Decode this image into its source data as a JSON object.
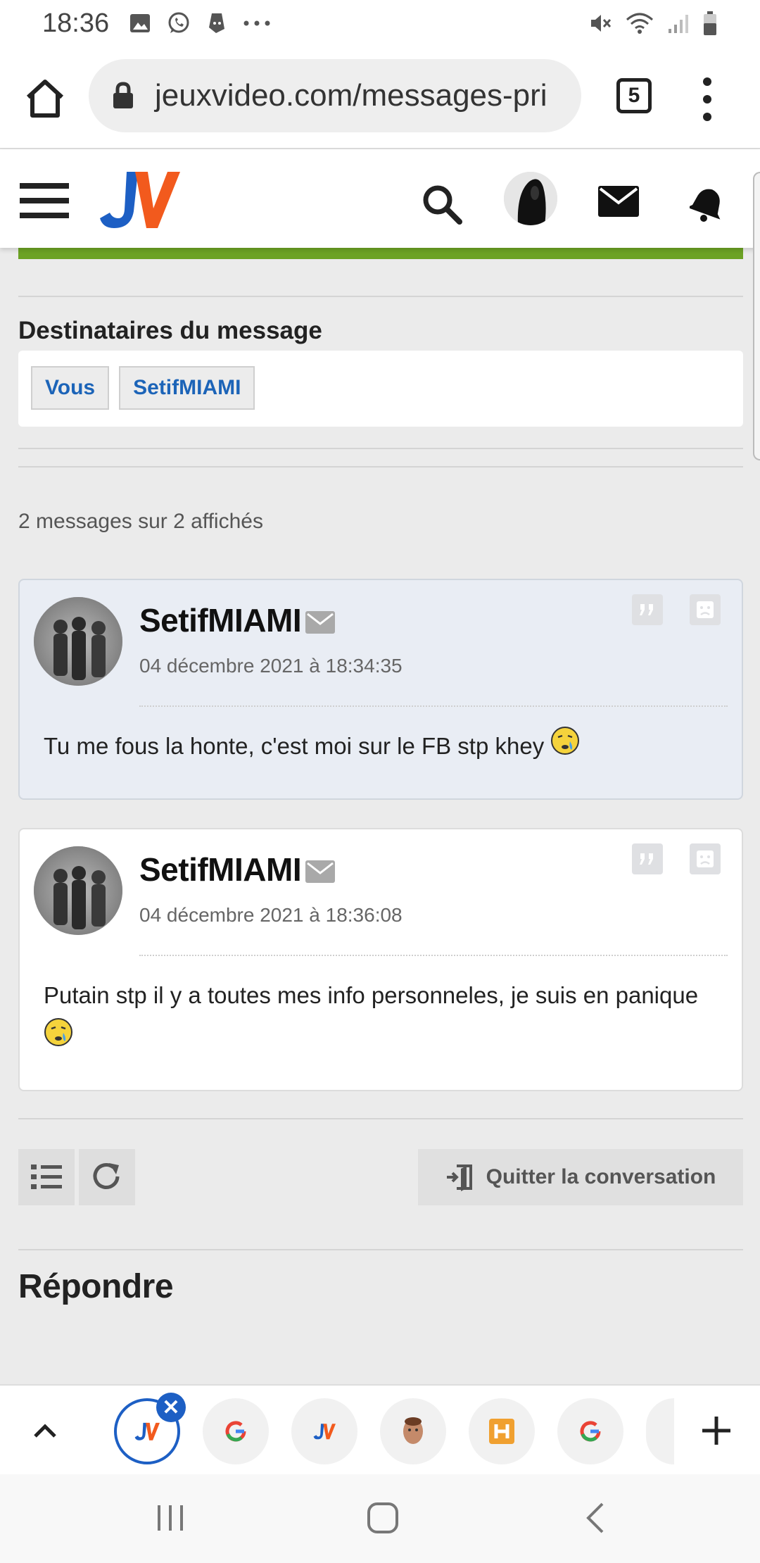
{
  "status_bar": {
    "time": "18:36",
    "icons": [
      "gallery-icon",
      "whatsapp-icon",
      "deliveroo-icon",
      "more-icon"
    ],
    "right_icons": [
      "mute-icon",
      "wifi-icon",
      "signal-icon",
      "battery-icon"
    ]
  },
  "browser": {
    "url": "jeuxvideo.com/messages-pri",
    "tab_count": "5"
  },
  "header": {
    "logo_text": "JV",
    "brand_colors": {
      "blue": "#1d5fc4",
      "orange": "#f25a1d"
    }
  },
  "recipients": {
    "title": "Destinataires du message",
    "tags": [
      "Vous",
      "SetifMIAMI"
    ]
  },
  "messages_count": "2 messages sur 2 affichés",
  "messages": [
    {
      "author": "SetifMIAMI",
      "date": "04 décembre 2021 à 18:34:35",
      "text": "Tu me fous la honte, c'est moi sur le FB stp khey"
    },
    {
      "author": "SetifMIAMI",
      "date": "04 décembre 2021 à 18:36:08",
      "text": "Putain stp il y a toutes mes info personneles, je suis en panique"
    }
  ],
  "actions": {
    "quit_label": "Quitter la conversation"
  },
  "reply": {
    "title": "Répondre"
  },
  "tabs": {
    "items": [
      "JV",
      "G",
      "JV",
      "avatar",
      "H",
      "G",
      "more"
    ]
  },
  "colors": {
    "accent_green": "#6ca224",
    "link_blue": "#1c64b8"
  }
}
